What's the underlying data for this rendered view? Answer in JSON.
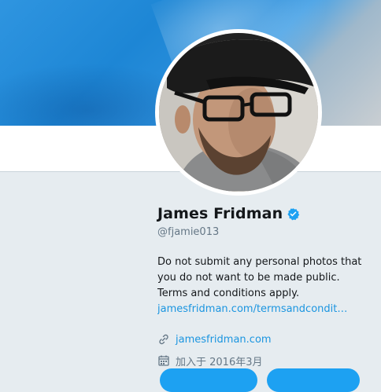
{
  "profile": {
    "display_name": "James Fridman",
    "handle": "@fjamie013",
    "bio_lines": [
      "Do not submit any personal photos that",
      "you do not want to be made public.",
      "Terms and conditions apply."
    ],
    "bio_link": "jamesfridman.com/termsandcondit…",
    "website": "jamesfridman.com",
    "joined": "加入于 2016年3月"
  },
  "icons": {
    "verified": "verified-badge-icon",
    "link": "link-icon",
    "calendar": "calendar-icon"
  },
  "colors": {
    "link_blue": "#1b95e0",
    "verified_blue": "#1da1f2",
    "text_dark": "#14171a",
    "text_gray": "#657786",
    "page_bg": "#e6ecf0"
  }
}
